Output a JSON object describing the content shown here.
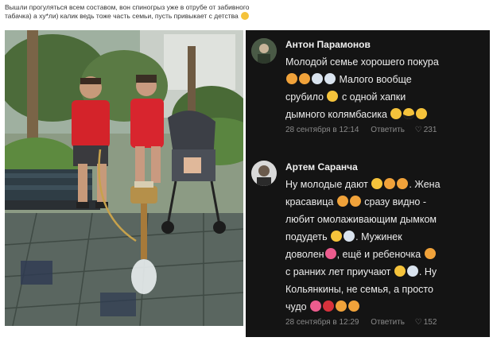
{
  "post": {
    "caption_line1": "Вышли прогуляться всем составом, вон спиногрыз уже в отрубе от забивного",
    "caption_line2": "табачка) а ху*ли) калик ведь тоже часть семьи, пусть привыкает с детства",
    "caption_emoji": "grinning-sweat-emoji"
  },
  "comments": [
    {
      "author": "Антон Парамонов",
      "lines": [
        "Молодой семье хорошего покура",
        "Малого вообще",
        "срубило",
        "с одной хапки",
        "дымного колямбасика"
      ],
      "emojis": [
        "folded-hands",
        "call-me-hand",
        "dash",
        "dash",
        "sleeping-face",
        "cool-face",
        "grin-face",
        "smile-face"
      ],
      "timestamp": "28 сентября в 12:14",
      "reply_label": "Ответить",
      "likes": "231"
    },
    {
      "author": "Артем Саранча",
      "lines": [
        "Ну молодые дают",
        ". Жена",
        "красавица",
        "сразу видно -",
        "любит омолаживающим дымком",
        "подудеть",
        ". Мужинек",
        "доволен",
        ", ещё и ребеночка",
        "с ранних лет приучают",
        ". Ну",
        "Кольянкины, не семья, а просто",
        "чудо"
      ],
      "timestamp": "28 сентября в 12:29",
      "reply_label": "Ответить",
      "likes": "152"
    }
  ],
  "colors": {
    "panel_bg": "#141414",
    "text": "#ececec",
    "meta": "#8a8a8a"
  }
}
